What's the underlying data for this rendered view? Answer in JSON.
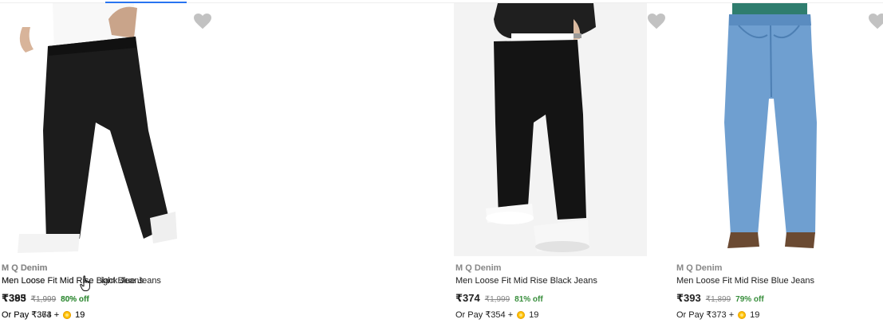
{
  "colors": {
    "discount_green": "#388e3c",
    "muted_gray": "#878787",
    "text_dark": "#212121",
    "wishlist_gray": "#c2c2c2",
    "coin_gold": "#ffc200"
  },
  "products": [
    {
      "brand": "M Q Denim",
      "title": "Men Loose Fit Mid Rise Black Jeans",
      "price": "₹374",
      "mrp": "₹1,999",
      "discount": "81% off",
      "or_pay": "Or Pay ₹354 +",
      "coins": "19",
      "image_icon": "black-jeans-photo",
      "wishlist_icon": "heart-icon"
    },
    {
      "brand": "M Q Denim",
      "title": "Men Loose Fit Mid Rise Blue Jeans",
      "price": "₹393",
      "mrp": "₹1,899",
      "discount": "79% off",
      "or_pay": "Or Pay ₹373 +",
      "coins": "19",
      "image_icon": "blue-jeans-photo",
      "wishlist_icon": "heart-icon"
    },
    {
      "brand": "M Q Denim",
      "title": "Men Loose Fit Mid Rise Light Blue Jeans",
      "price": "₹383",
      "mrp": "₹1,999",
      "discount": "80% off",
      "or_pay": "Or Pay ₹363 +",
      "coins": "19",
      "image_icon": "light-blue-jeans-photo",
      "wishlist_icon": "heart-icon"
    },
    {
      "brand": "M Q Denim",
      "title": "Men Loose Fit Mid Rise Black Jeans",
      "price": "₹395",
      "mrp": "₹1,999",
      "discount": "80% off",
      "or_pay": "Or Pay ₹374 +",
      "coins": "19",
      "image_icon": "black-jeans-photo",
      "wishlist_icon": "heart-icon"
    }
  ]
}
